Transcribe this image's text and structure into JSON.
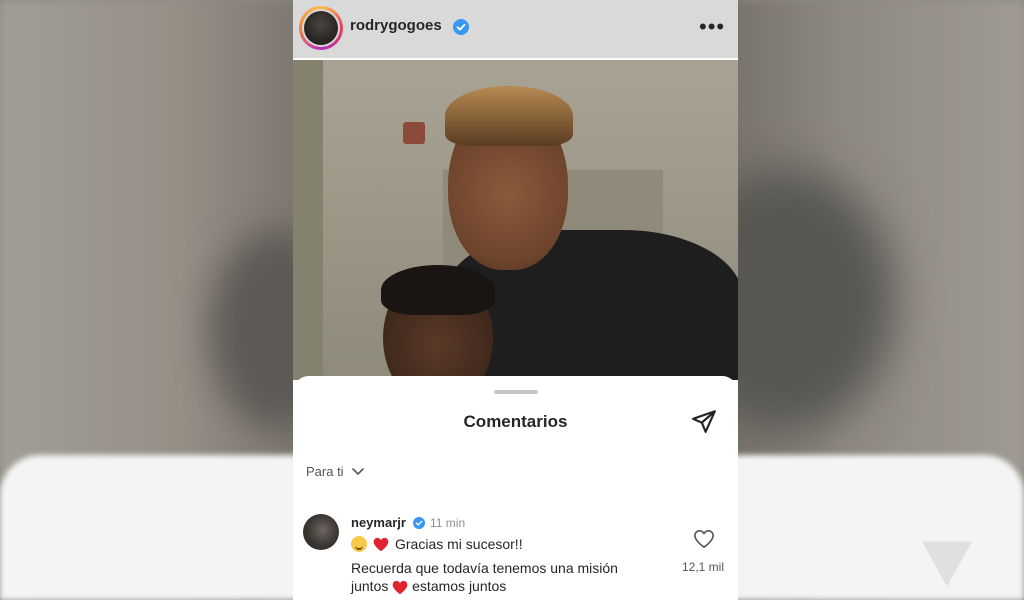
{
  "post": {
    "username": "rodrygogoes",
    "more_label": "•••"
  },
  "comments_sheet": {
    "title": "Comentarios",
    "filter_label": "Para ti"
  },
  "comment": {
    "username": "neymarjr",
    "time": "11 min",
    "line1_text": "Gracias mi sucesor!!",
    "line2_a": "Recuerda que todavía tenemos una misión",
    "line2_b": "juntos",
    "line2_c": "estamos juntos",
    "likes": "12,1 mil"
  },
  "colors": {
    "verified": "#3897f0",
    "heart": "#e0242f"
  },
  "icons": [
    "verified-badge-icon",
    "more-options-icon",
    "share-icon",
    "chevron-down-icon",
    "heart-outline-icon",
    "red-heart-emoji",
    "smiling-tear-emoji"
  ]
}
